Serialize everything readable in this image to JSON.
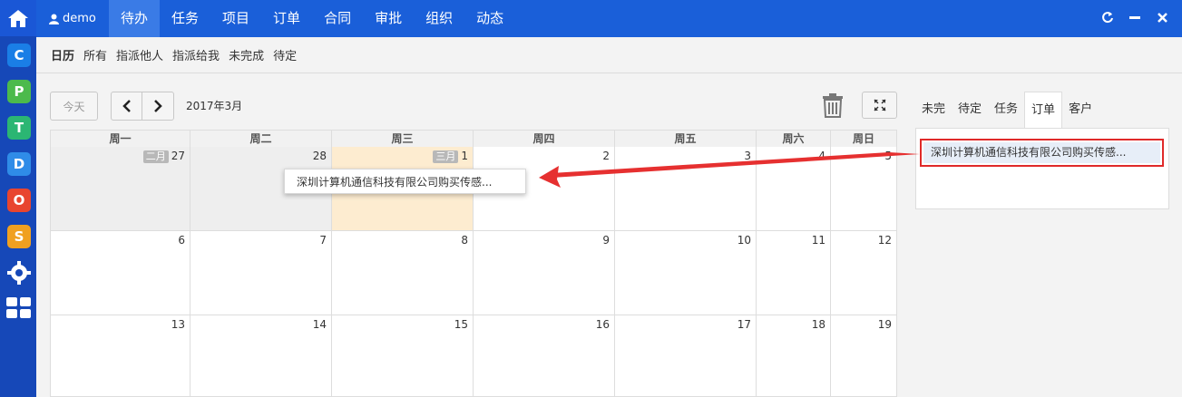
{
  "user": {
    "name": "demo"
  },
  "top_nav": [
    "待办",
    "任务",
    "项目",
    "订单",
    "合同",
    "审批",
    "组织",
    "动态"
  ],
  "top_nav_active": 0,
  "sub_nav": [
    "日历",
    "所有",
    "指派他人",
    "指派给我",
    "未完成",
    "待定"
  ],
  "sub_nav_active": 0,
  "toolbar": {
    "today_label": "今天",
    "month_label": "2017年3月"
  },
  "app_icons": [
    {
      "letter": "C",
      "color": "#1a7ee6"
    },
    {
      "letter": "P",
      "color": "#4cba4c"
    },
    {
      "letter": "T",
      "color": "#2bb673"
    },
    {
      "letter": "D",
      "color": "#2f8ce8"
    },
    {
      "letter": "O",
      "color": "#e8452f"
    },
    {
      "letter": "S",
      "color": "#f0a020"
    }
  ],
  "calendar": {
    "weekdays": [
      "周一",
      "周二",
      "周三",
      "周四",
      "周五",
      "周六",
      "周日"
    ],
    "weeks": [
      [
        {
          "label": "二月",
          "day": "27",
          "other": true
        },
        {
          "day": "28",
          "other": true
        },
        {
          "label": "三月",
          "day": "1",
          "today": true
        },
        {
          "day": "2"
        },
        {
          "day": "3"
        },
        {
          "day": "4"
        },
        {
          "day": "5"
        }
      ],
      [
        {
          "day": "6"
        },
        {
          "day": "7"
        },
        {
          "day": "8"
        },
        {
          "day": "9"
        },
        {
          "day": "10"
        },
        {
          "day": "11"
        },
        {
          "day": "12"
        }
      ],
      [
        {
          "day": "13"
        },
        {
          "day": "14"
        },
        {
          "day": "15"
        },
        {
          "day": "16"
        },
        {
          "day": "17"
        },
        {
          "day": "18"
        },
        {
          "day": "19"
        }
      ]
    ],
    "event_popup": "深圳计算机通信科技有限公司购买传感..."
  },
  "right_panel": {
    "tabs": [
      "未完",
      "待定",
      "任务",
      "订单",
      "客户"
    ],
    "active_tab": 3,
    "items": [
      "深圳计算机通信科技有限公司购买传感..."
    ]
  },
  "colors": {
    "accent": "#1a5fd9",
    "highlight": "#e02a2a",
    "today": "#fdecd0"
  }
}
